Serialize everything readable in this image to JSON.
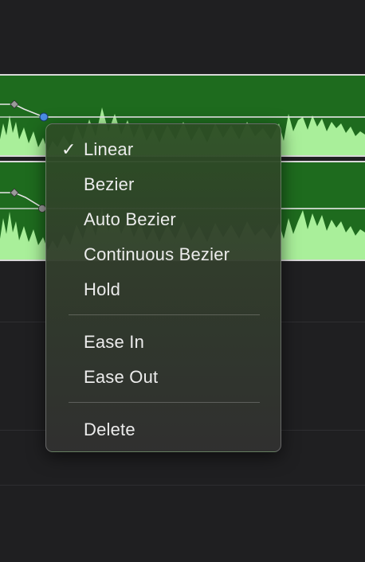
{
  "colors": {
    "background": "#1f1f21",
    "track_fill": "#1e6b1e",
    "waveform": "#a9ef9a",
    "keyframe_selected": "#4a8ee6",
    "keyframe": "#9a9a9a"
  },
  "context_menu": {
    "items": [
      {
        "label": "Linear",
        "checked": "✓"
      },
      {
        "label": "Bezier"
      },
      {
        "label": "Auto Bezier"
      },
      {
        "label": "Continuous Bezier"
      },
      {
        "label": "Hold"
      },
      {
        "label": "Ease In"
      },
      {
        "label": "Ease Out"
      },
      {
        "label": "Delete"
      }
    ]
  }
}
